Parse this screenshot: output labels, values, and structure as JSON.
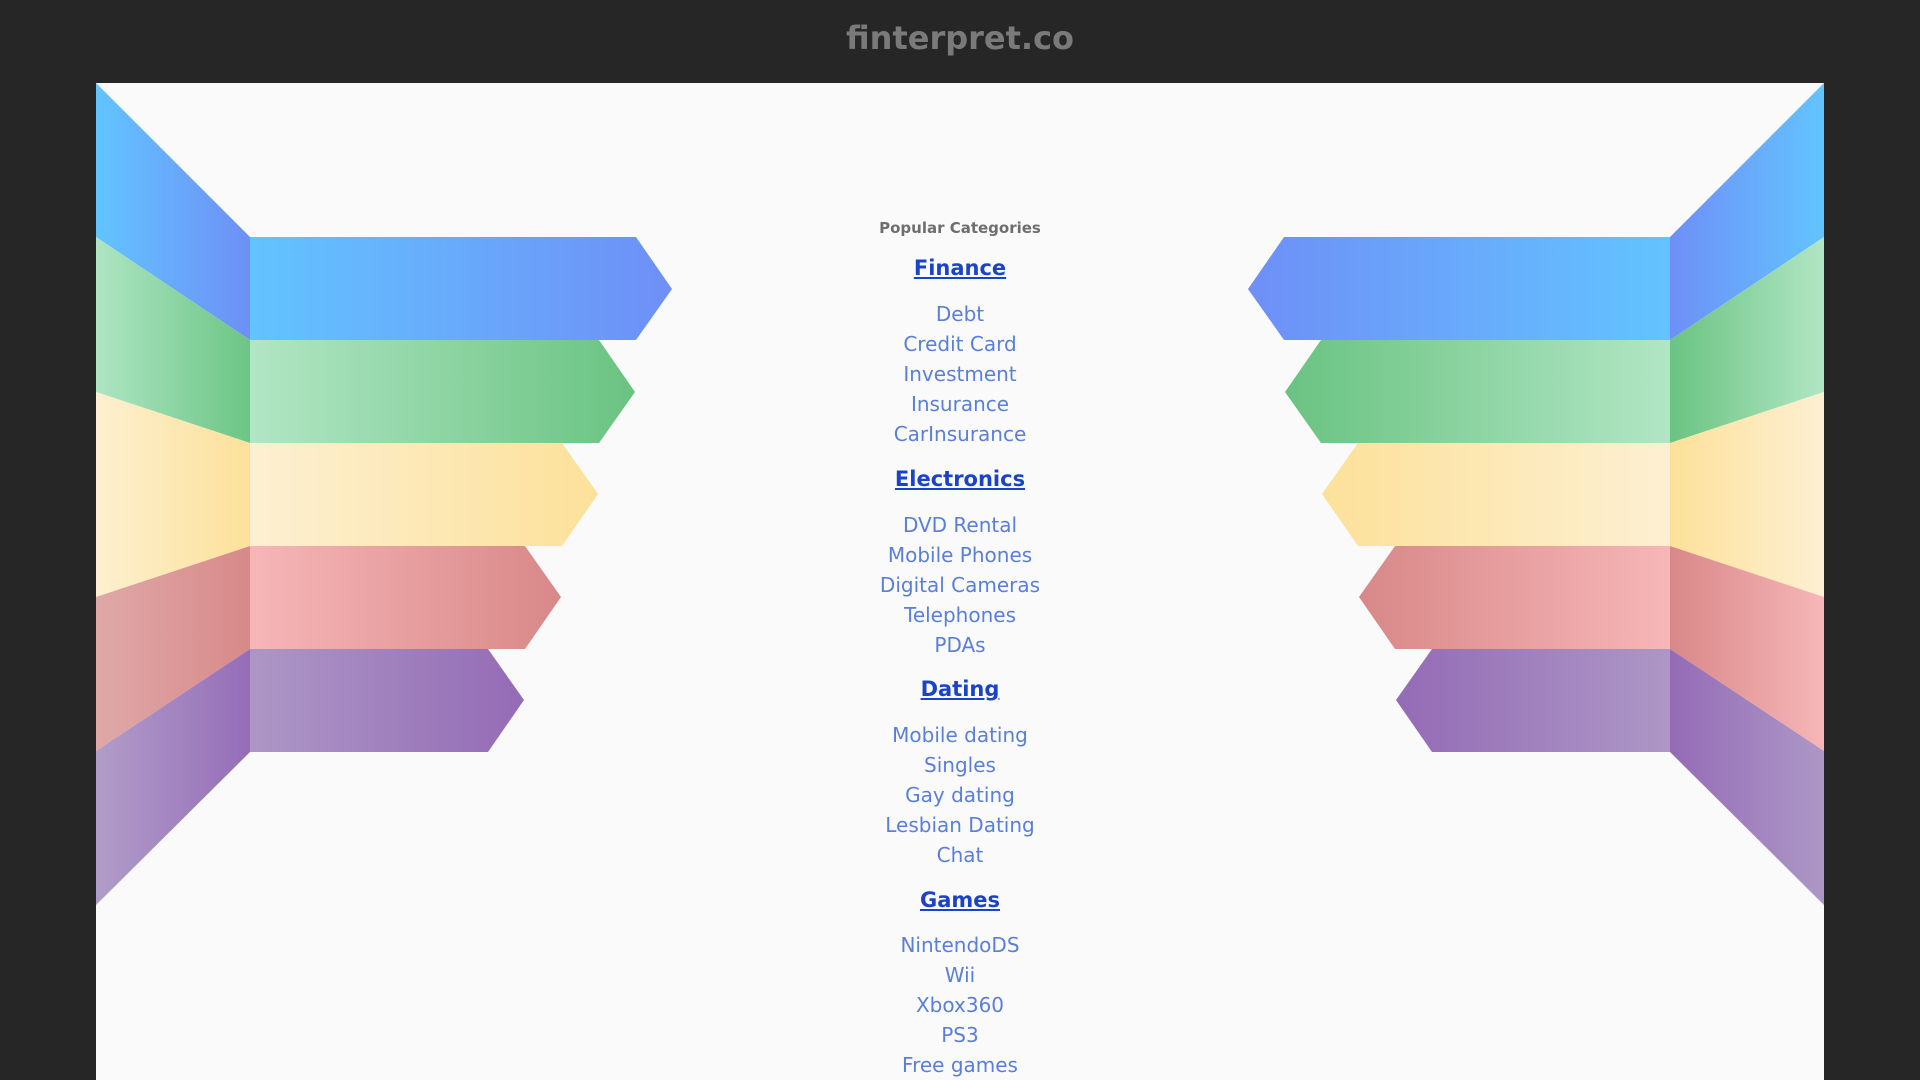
{
  "site_title": "finterpret.co",
  "popular_heading": "Popular Categories",
  "categories": [
    {
      "title": "Finance",
      "links": [
        "Debt",
        "Credit Card",
        "Investment",
        "Insurance",
        "CarInsurance"
      ]
    },
    {
      "title": "Electronics",
      "links": [
        "DVD Rental",
        "Mobile Phones",
        "Digital Cameras",
        "Telephones",
        "PDAs"
      ]
    },
    {
      "title": "Dating",
      "links": [
        "Mobile dating",
        "Singles",
        "Gay dating",
        "Lesbian Dating",
        "Chat"
      ]
    },
    {
      "title": "Games",
      "links": [
        "NintendoDS",
        "Wii",
        "Xbox360",
        "PS3",
        "Free games"
      ]
    }
  ],
  "colors": {
    "page_bg": "#262626",
    "panel_bg": "#fafafa",
    "title_color": "#7a7a7a",
    "category_link": "#1a43c8",
    "sub_link": "#5a7fd8",
    "band_blue": "#66a3f5",
    "band_green": "#7dcf97",
    "band_yellow": "#fde7ad",
    "band_pink": "#e7a2a2",
    "band_purple": "#a38ac1"
  }
}
